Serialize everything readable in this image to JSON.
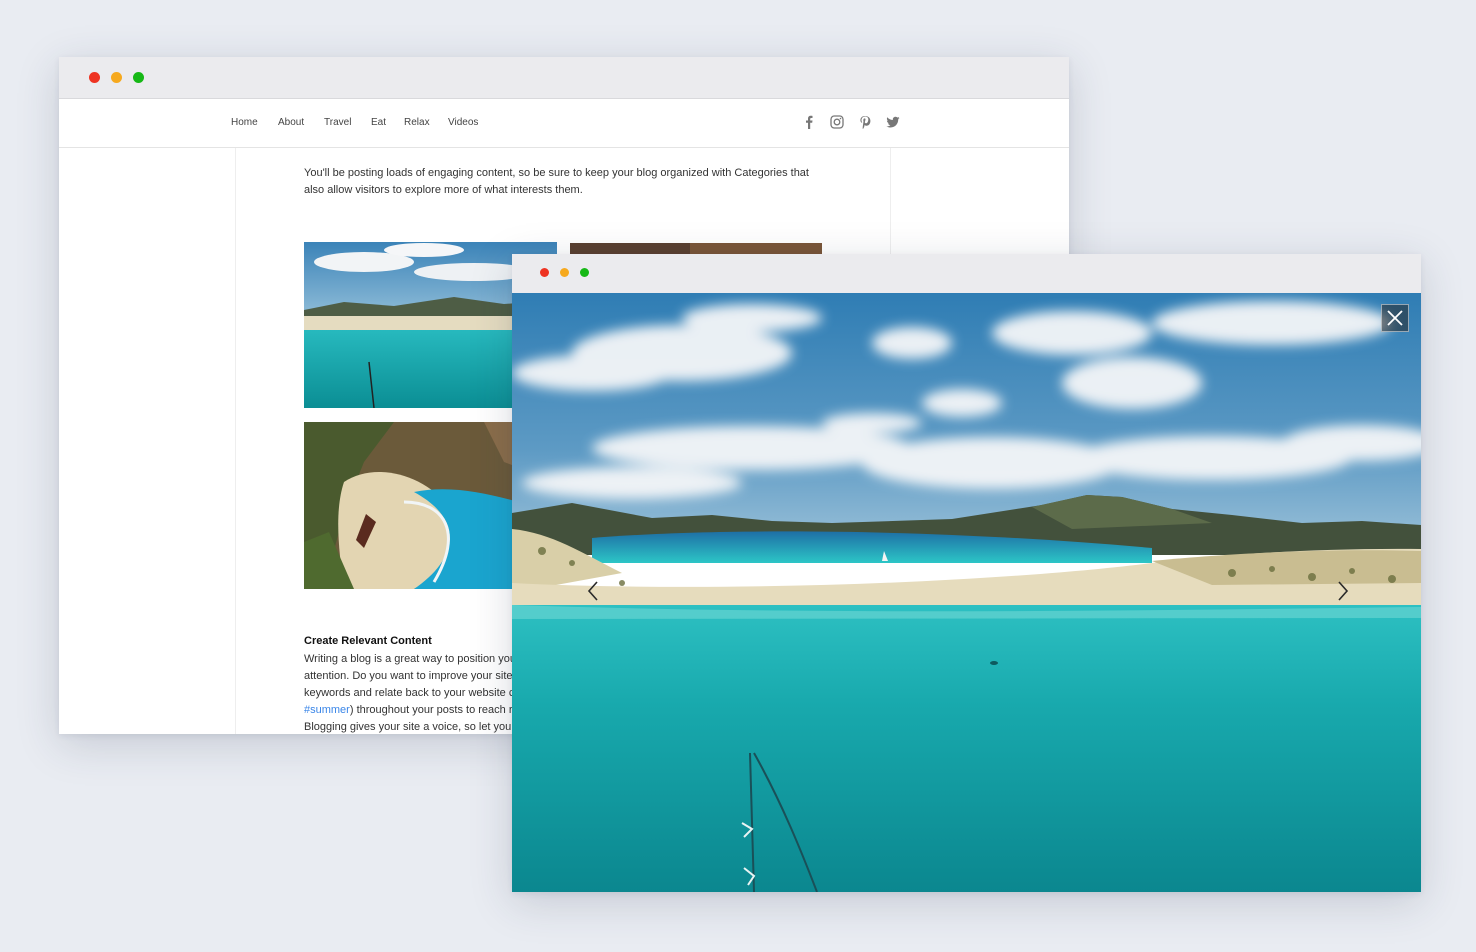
{
  "back_window": {
    "nav": {
      "items": [
        "Home",
        "About",
        "Travel",
        "Eat",
        "Relax",
        "Videos"
      ],
      "social_icons": [
        "facebook-icon",
        "instagram-icon",
        "pinterest-icon",
        "twitter-icon"
      ]
    },
    "post": {
      "intro": "You'll be posting loads of engaging content, so be sure to keep your blog organized with Categories that also allow visitors to explore more of what interests them.",
      "section_heading": "Create Relevant Content",
      "body_lines": [
        "Writing a blog is a great way to position you",
        "attention. Do you want to improve your site",
        "keywords and relate back to your website c"
      ],
      "hashtag": "#summer",
      "hashtag_after": ") throughout your posts to reach r",
      "last_line": "Blogging gives your site a voice, so let your"
    }
  },
  "front_window": {
    "close_icon": "close-icon",
    "prev_icon": "chevron-left-icon",
    "next_icon": "chevron-right-icon"
  },
  "colors": {
    "background": "#e9ecf2",
    "traffic_red": "#ee3322",
    "traffic_yellow": "#f6a91e",
    "traffic_green": "#16b816",
    "link": "#3a86e8"
  }
}
